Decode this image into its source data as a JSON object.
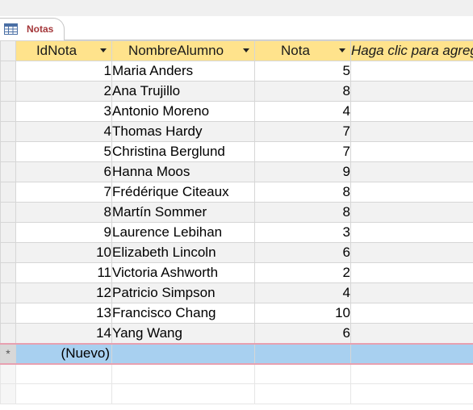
{
  "tab": {
    "label": "Notas",
    "icon": "table-icon"
  },
  "columns": {
    "id": "IdNota",
    "name": "NombreAlumno",
    "nota": "Nota",
    "add": "Haga clic para agregar"
  },
  "rows": [
    {
      "id": "1",
      "name": "Maria Anders",
      "nota": "5"
    },
    {
      "id": "2",
      "name": "Ana Trujillo",
      "nota": "8"
    },
    {
      "id": "3",
      "name": "Antonio Moreno",
      "nota": "4"
    },
    {
      "id": "4",
      "name": "Thomas Hardy",
      "nota": "7"
    },
    {
      "id": "5",
      "name": "Christina Berglund",
      "nota": "7"
    },
    {
      "id": "6",
      "name": "Hanna Moos",
      "nota": "9"
    },
    {
      "id": "7",
      "name": "Frédérique Citeaux",
      "nota": "8"
    },
    {
      "id": "8",
      "name": "Martín Sommer",
      "nota": "8"
    },
    {
      "id": "9",
      "name": "Laurence Lebihan",
      "nota": "3"
    },
    {
      "id": "10",
      "name": "Elizabeth Lincoln",
      "nota": "6"
    },
    {
      "id": "11",
      "name": "Victoria Ashworth",
      "nota": "2"
    },
    {
      "id": "12",
      "name": "Patricio Simpson",
      "nota": "4"
    },
    {
      "id": "13",
      "name": "Francisco Chang",
      "nota": "10"
    },
    {
      "id": "14",
      "name": "Yang Wang",
      "nota": "6"
    }
  ],
  "new_row": {
    "marker": "*",
    "label": "(Nuevo)"
  },
  "colors": {
    "header": "#ffe38c",
    "new_row": "#a8d0f0",
    "tab_text": "#a4373a"
  }
}
